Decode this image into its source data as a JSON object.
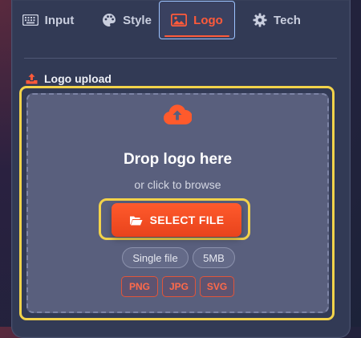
{
  "tabs": [
    {
      "label": "Input",
      "icon": "keyboard-icon"
    },
    {
      "label": "Style",
      "icon": "palette-icon"
    },
    {
      "label": "Logo",
      "icon": "image-icon",
      "active": true
    },
    {
      "label": "Tech",
      "icon": "gear-icon"
    }
  ],
  "section": {
    "label": "Logo upload",
    "icon": "upload-icon"
  },
  "dropzone": {
    "icon": "cloud-upload-icon",
    "title": "Drop logo here",
    "subtitle": "or click to browse",
    "button_label": "SELECT FILE",
    "button_icon": "folder-open-icon",
    "info_pills": [
      "Single file",
      "5MB"
    ],
    "formats": [
      "PNG",
      "JPG",
      "SVG"
    ]
  },
  "colors": {
    "accent": "#ff5a2c",
    "focus_ring": "#f3d34a",
    "active_tab_border": "#9cc3ff",
    "panel": "#323a55",
    "dropzone": "#595f7d"
  }
}
